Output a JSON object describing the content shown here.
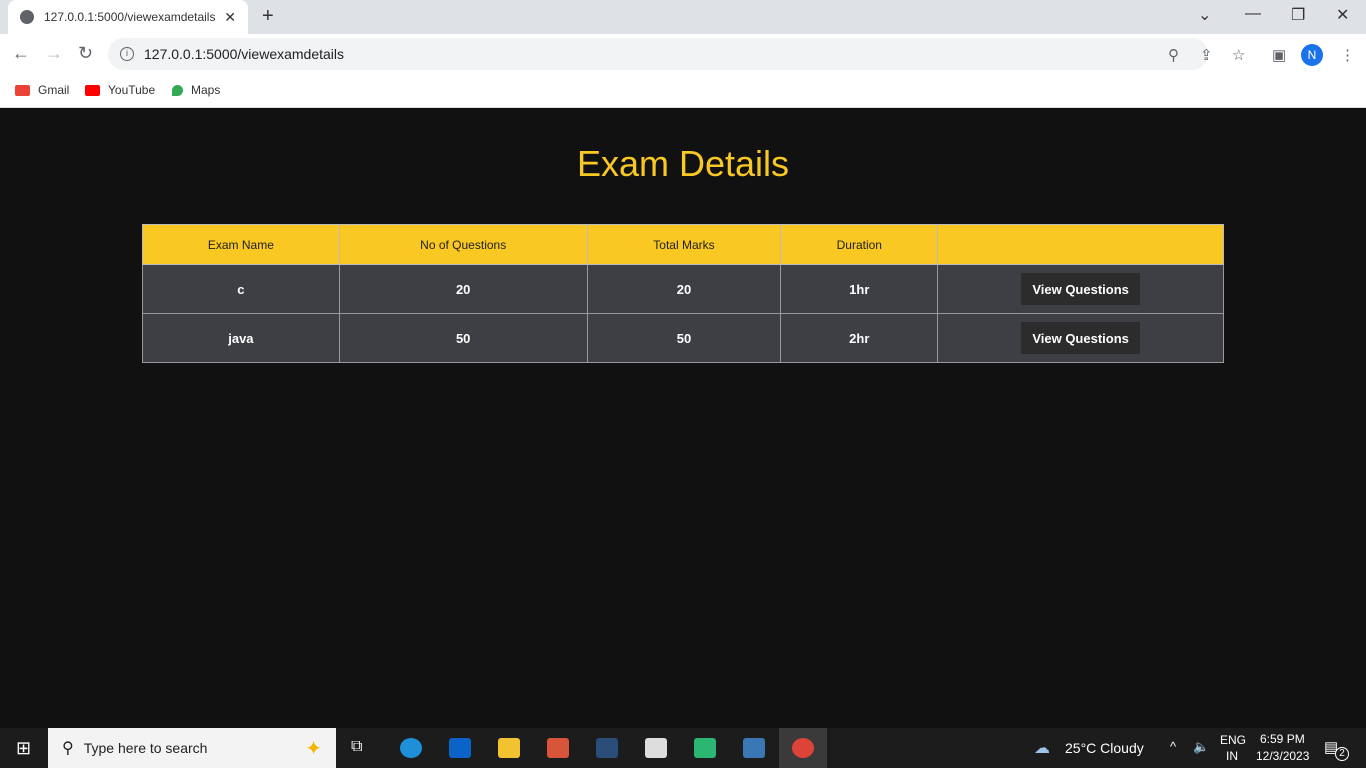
{
  "browser": {
    "tab_title": "127.0.0.1:5000/viewexamdetails",
    "url": "127.0.0.1:5000/viewexamdetails",
    "profile_initial": "N",
    "bookmarks": [
      {
        "label": "Gmail",
        "color": "#ea4335"
      },
      {
        "label": "YouTube",
        "color": "#ff0000"
      },
      {
        "label": "Maps",
        "color": "#34a853"
      }
    ]
  },
  "page": {
    "title": "Exam Details",
    "columns": [
      "Exam Name",
      "No of Questions",
      "Total Marks",
      "Duration",
      ""
    ],
    "rows": [
      {
        "name": "c",
        "questions": "20",
        "marks": "20",
        "duration": "1hr",
        "action": "View Questions"
      },
      {
        "name": "java",
        "questions": "50",
        "marks": "50",
        "duration": "2hr",
        "action": "View Questions"
      }
    ]
  },
  "taskbar": {
    "search_placeholder": "Type here to search",
    "weather": "25°C  Cloudy",
    "lang": "ENG",
    "region": "IN",
    "time": "6:59 PM",
    "date": "12/3/2023",
    "notifications": "2"
  }
}
